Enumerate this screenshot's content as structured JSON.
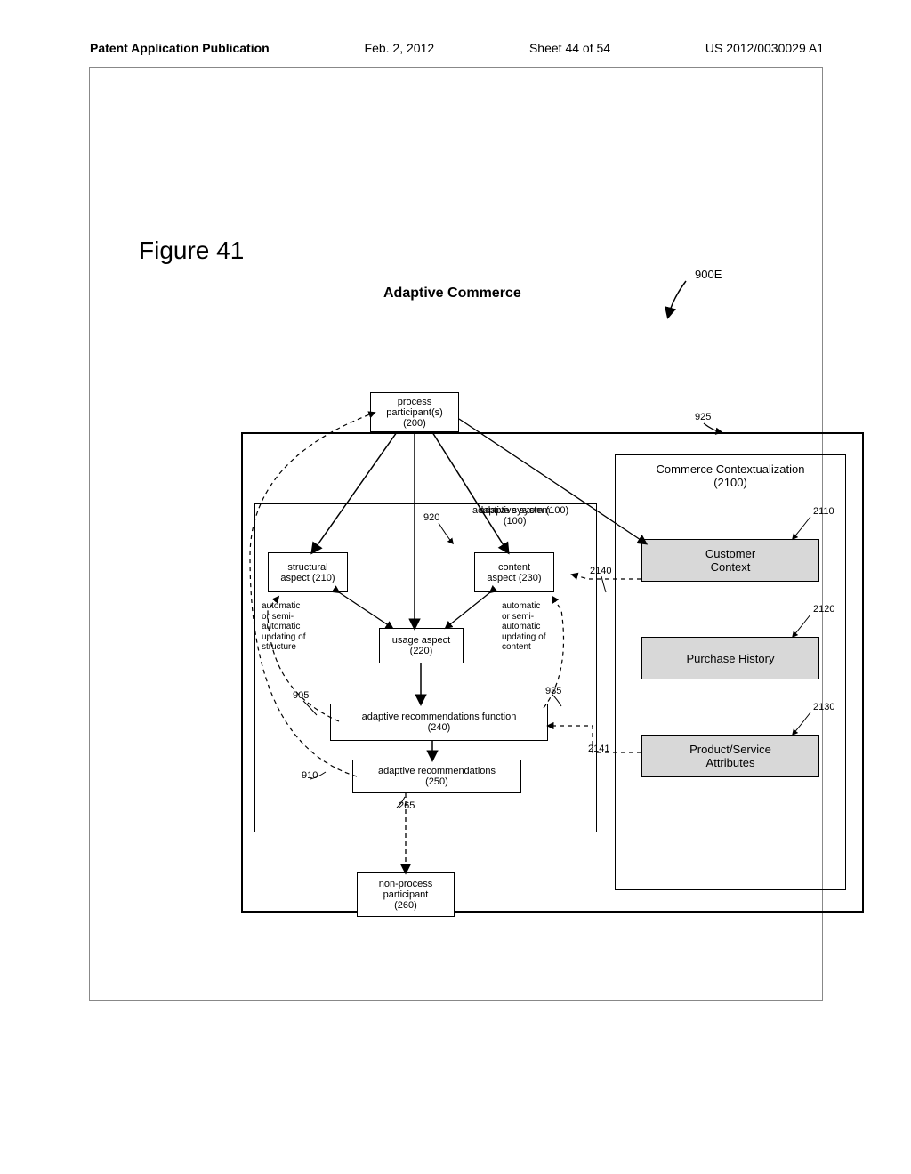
{
  "header": {
    "left": "Patent Application Publication",
    "mid": "Feb. 2, 2012",
    "sheet": "Sheet 44 of 54",
    "right": "US 2012/0030029 A1"
  },
  "figure": {
    "title": "Figure 41",
    "subtitle": "Adaptive Commerce"
  },
  "refs": {
    "r900E": "900E",
    "r925": "925",
    "r920": "920",
    "r905": "905",
    "r910": "910",
    "r935": "935",
    "r265": "265",
    "r2140": "2140",
    "r2141": "2141",
    "r2110": "2110",
    "r2120": "2120",
    "r2130": "2130"
  },
  "boxes": {
    "participants": "process\nparticipant(s)\n(200)",
    "adaptive_system": "adaptive system\n(100)",
    "structural": "structural\naspect (210)",
    "content": "content\naspect (230)",
    "usage": "usage aspect\n(220)",
    "rec_func": "adaptive recommendations function\n(240)",
    "recs": "adaptive recommendations\n(250)",
    "nonprocess": "non-process\nparticipant\n(260)",
    "commerce_ctx": "Commerce Contextualization\n(2100)",
    "customer_ctx": "Customer\nContext",
    "purchase_hist": "Purchase History",
    "prod_attrs": "Product/Service\nAttributes"
  },
  "notes": {
    "auto_structure": "automatic\nor semi-\nautomatic\nupdating of\nstructure",
    "auto_content": "automatic\nor semi-\nautomatic\nupdating of\ncontent"
  }
}
